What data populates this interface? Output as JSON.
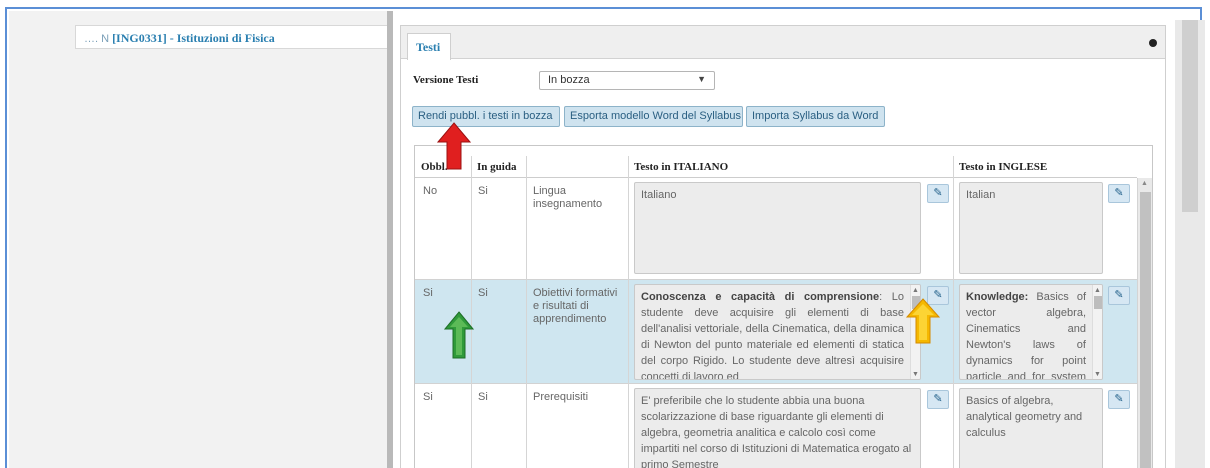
{
  "sidebar": {
    "course_prefix": "…. N",
    "course_label": "[ING0331] - Istituzioni di Fisica"
  },
  "panel": {
    "tab_label": "Testi",
    "version_label": "Versione Testi",
    "version_value": "In bozza",
    "buttons": {
      "publish": "Rendi pubbl. i testi in bozza",
      "export": "Esporta modello Word del Syllabus",
      "import": "Importa Syllabus da Word"
    }
  },
  "table": {
    "headers": {
      "obbl": "Obbl.",
      "in_guida": "In guida",
      "name": "",
      "italian": "Testo in ITALIANO",
      "english": "Testo in INGLESE"
    },
    "rows": [
      {
        "obbl": "No",
        "in_guida": "Si",
        "name": "Lingua insegnamento",
        "it_bold": "",
        "it_text": "Italiano",
        "en_bold": "",
        "en_text": "Italian"
      },
      {
        "obbl": "Si",
        "in_guida": "Si",
        "name": "Obiettivi formativi e risultati di apprendimento",
        "it_bold": "Conoscenza e capacità di comprensione",
        "it_text": ": Lo studente deve acquisire gli elementi di base dell'analisi vettoriale, della Cinematica, della dinamica di Newton del punto materiale ed elementi di statica del corpo Rigido. Lo studente deve altresì acquisire concetti di lavoro ed",
        "en_bold": "Knowledge:",
        "en_text": " Basics of vector algebra, Cinematics and Newton's laws of dynamics for point particle and for system of"
      },
      {
        "obbl": "Si",
        "in_guida": "Si",
        "name": "Prerequisiti",
        "it_bold": "",
        "it_text": "E' preferibile che lo studente abbia una buona scolarizzazione di base riguardante gli elementi di algebra, geometria analitica e calcolo così come impartiti nel corso di Istituzioni di Matematica erogato al primo Semestre",
        "en_bold": "",
        "en_text": "Basics of algebra, analytical geometry and calculus"
      }
    ]
  },
  "icons": {
    "edit": "pencil-icon",
    "collapse": "circle-icon",
    "dropdown": "caret-down-icon"
  },
  "colors": {
    "accent": "#2a7fb0",
    "selected_row": "#cfe6f0",
    "arrow_red": "#e01f1f",
    "arrow_green": "#2f9a3a",
    "arrow_yellow": "#f5b800"
  }
}
